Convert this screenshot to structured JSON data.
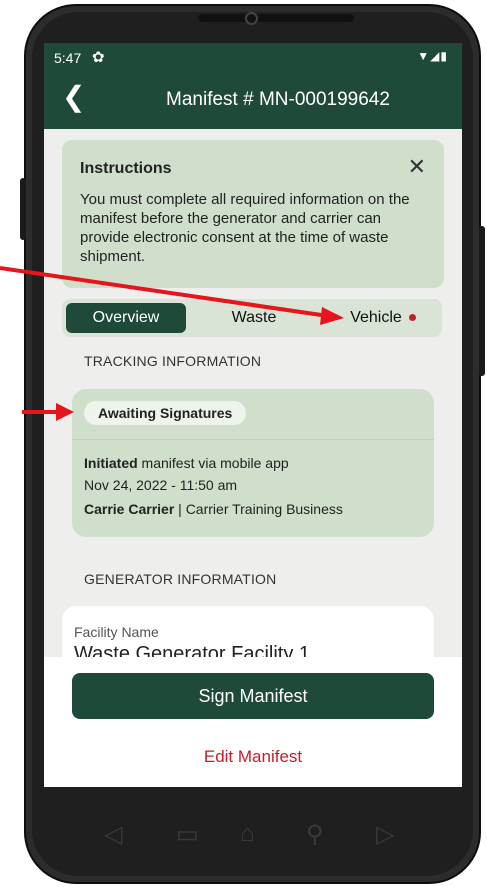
{
  "status_bar": {
    "time": "5:47",
    "settings_icon": "gear-icon",
    "right_icons": "▼◢▮"
  },
  "app_bar": {
    "back_icon": "chevron-left-icon",
    "back_glyph": "❮",
    "title": "Manifest # MN-000199642"
  },
  "instructions": {
    "heading": "Instructions",
    "close_glyph": "✕",
    "body": "You must complete all required information on the manifest before the generator and carrier can provide electronic consent at the time of waste shipment."
  },
  "tabs": [
    {
      "label": "Overview",
      "active": true
    },
    {
      "label": "Waste",
      "active": false
    },
    {
      "label": "Vehicle",
      "active": false,
      "has_alert_dot": true
    }
  ],
  "tracking": {
    "section_title": "TRACKING INFORMATION",
    "status_badge": "Awaiting Signatures",
    "action_bold": "Initiated",
    "action_rest": " manifest via mobile app",
    "timestamp": "Nov 24, 2022 - 11:50 am",
    "person": "Carrie Carrier",
    "organization": " | Carrier Training Business"
  },
  "generator": {
    "section_title": "GENERATOR INFORMATION",
    "facility_label": "Facility Name",
    "facility_value": "Waste Generator Facility 1"
  },
  "actions": {
    "sign_label": "Sign Manifest",
    "edit_label": "Edit Manifest"
  },
  "nav_bar": {
    "back": "◁",
    "recents": "▭",
    "home": "⌂",
    "search": "⚲",
    "forward": "▷"
  },
  "colors": {
    "brand": "#1f4a3a",
    "panel": "#cfdfcb",
    "accent_red": "#c41e2a",
    "annotation_arrow": "#e8141c"
  }
}
